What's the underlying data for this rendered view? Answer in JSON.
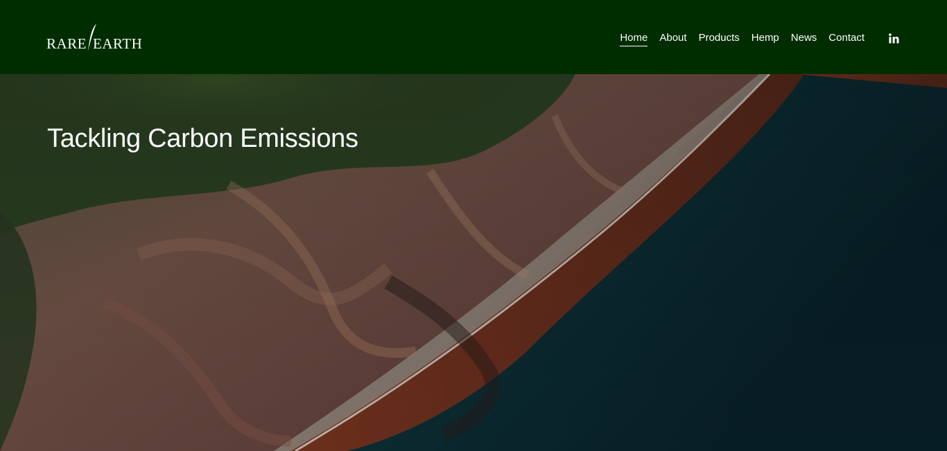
{
  "brand": {
    "name_left": "RARE",
    "name_right": "EARTH",
    "logo_icon": "leaf-slash-icon"
  },
  "nav": {
    "items": [
      {
        "label": "Home",
        "active": true
      },
      {
        "label": "About",
        "active": false
      },
      {
        "label": "Products",
        "active": false
      },
      {
        "label": "Hemp",
        "active": false
      },
      {
        "label": "News",
        "active": false
      },
      {
        "label": "Contact",
        "active": false
      }
    ],
    "social_icon": "linkedin-icon"
  },
  "hero": {
    "title": "Tackling Carbon Emissions",
    "image": "aerial-coastline-cliffs-photo"
  },
  "colors": {
    "header_bg": "#002d00",
    "text": "#ffffff",
    "sea_deep": "#0c2e33",
    "sea_red": "#7a3220",
    "cliff": "#6b4a40",
    "vegetation": "#2e4a22"
  }
}
